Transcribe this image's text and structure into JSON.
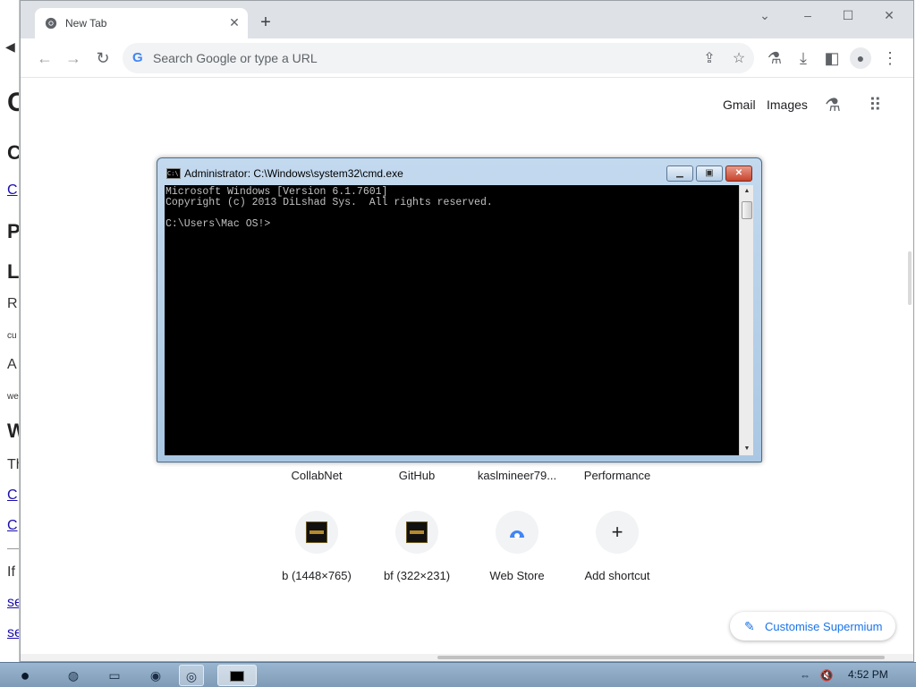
{
  "background_page": {
    "lines": [
      {
        "text": "C",
        "style": "big"
      },
      {
        "text": "C",
        "style": "h"
      },
      {
        "text": "C",
        "style": "lnk"
      },
      {
        "text": "P",
        "style": "h"
      },
      {
        "text": "L",
        "style": "h"
      },
      {
        "text": "R",
        "style": "txt"
      },
      {
        "text": "cu",
        "style": "small"
      },
      {
        "text": "A",
        "style": "txt"
      },
      {
        "text": "we",
        "style": "small"
      },
      {
        "text": "W",
        "style": "h"
      },
      {
        "text": "Th",
        "style": "txt"
      },
      {
        "text": "C",
        "style": "lnk"
      },
      {
        "text": "C",
        "style": "lnk"
      },
      {
        "text": "If",
        "style": "txt"
      },
      {
        "text": "se",
        "style": "lnk"
      },
      {
        "text": "se",
        "style": "lnk"
      }
    ]
  },
  "browser": {
    "tab_title": "New Tab",
    "omnibox_placeholder": "Search Google or type a URL",
    "header_links": {
      "gmail": "Gmail",
      "images": "Images"
    },
    "shortcuts_row1": [
      "CollabNet",
      "GitHub",
      "kaslmineer79...",
      "Performance"
    ],
    "shortcuts_row2": [
      "b (1448×765)",
      "bf (322×231)",
      "Web Store",
      "Add shortcut"
    ],
    "customise_label": "Customise Supermium"
  },
  "cmd": {
    "title": "Administrator: C:\\Windows\\system32\\cmd.exe",
    "lines": [
      "Microsoft Windows [Version 6.1.7601]",
      "Copyright (c) 2013 DiLshad Sys.  All rights reserved.",
      "",
      "C:\\Users\\Mac OS!>"
    ]
  },
  "taskbar": {
    "clock": "4:52 PM"
  }
}
